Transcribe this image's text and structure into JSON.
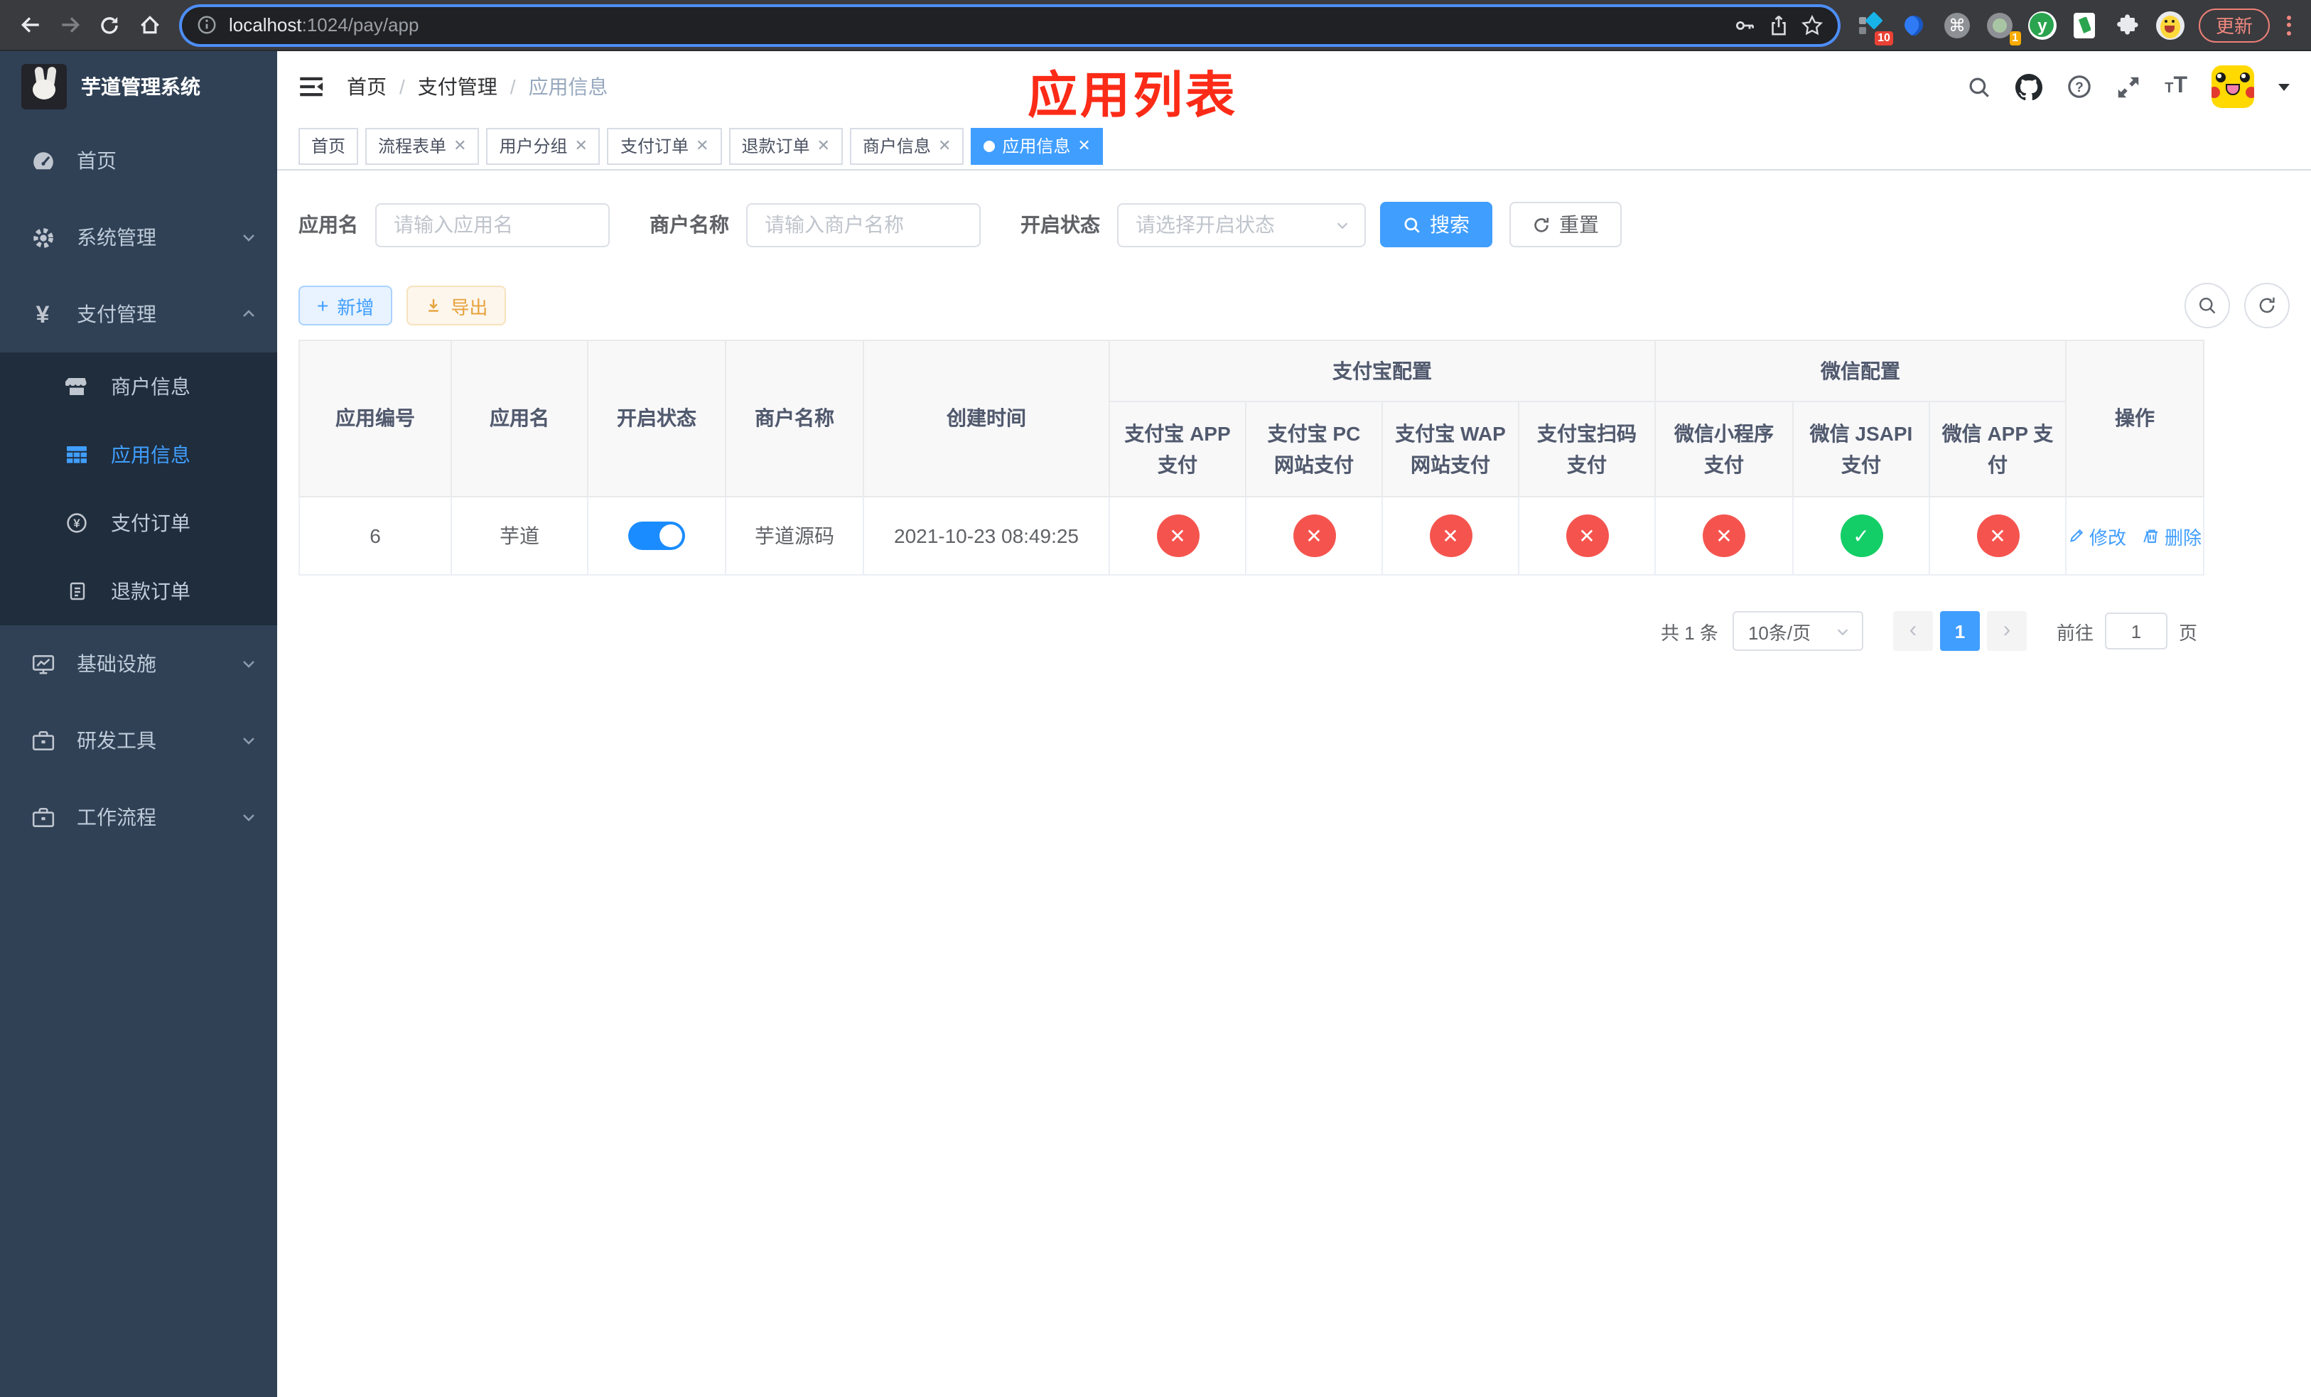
{
  "browser": {
    "url_host": "localhost",
    "url_path": ":1024/pay/app",
    "ext_badge_10": "10",
    "ext_badge_1": "1",
    "ext_y_label": "y",
    "update_label": "更新"
  },
  "sidebar": {
    "title": "芋道管理系统",
    "items": [
      {
        "label": "首页"
      },
      {
        "label": "系统管理"
      },
      {
        "label": "支付管理"
      },
      {
        "label": "商户信息"
      },
      {
        "label": "应用信息"
      },
      {
        "label": "支付订单"
      },
      {
        "label": "退款订单"
      },
      {
        "label": "基础设施"
      },
      {
        "label": "研发工具"
      },
      {
        "label": "工作流程"
      }
    ]
  },
  "navbar": {
    "breadcrumb": [
      "首页",
      "支付管理",
      "应用信息"
    ],
    "annotation": "应用列表"
  },
  "tabs": [
    {
      "label": "首页",
      "closable": false,
      "active": false
    },
    {
      "label": "流程表单",
      "closable": true,
      "active": false
    },
    {
      "label": "用户分组",
      "closable": true,
      "active": false
    },
    {
      "label": "支付订单",
      "closable": true,
      "active": false
    },
    {
      "label": "退款订单",
      "closable": true,
      "active": false
    },
    {
      "label": "商户信息",
      "closable": true,
      "active": false
    },
    {
      "label": "应用信息",
      "closable": true,
      "active": true
    }
  ],
  "filters": {
    "app_name_label": "应用名",
    "app_name_placeholder": "请输入应用名",
    "merchant_label": "商户名称",
    "merchant_placeholder": "请输入商户名称",
    "status_label": "开启状态",
    "status_placeholder": "请选择开启状态",
    "search_label": "搜索",
    "reset_label": "重置"
  },
  "toolbar": {
    "add_label": "新增",
    "export_label": "导出"
  },
  "table": {
    "columns": [
      "应用编号",
      "应用名",
      "开启状态",
      "商户名称",
      "创建时间"
    ],
    "groups": [
      {
        "label": "支付宝配置",
        "children": [
          "支付宝 APP 支付",
          "支付宝 PC 网站支付",
          "支付宝 WAP 网站支付",
          "支付宝扫码支付"
        ]
      },
      {
        "label": "微信配置",
        "children": [
          "微信小程序支付",
          "微信 JSAPI 支付",
          "微信 APP 支付"
        ]
      }
    ],
    "ops_label": "操作",
    "row": {
      "id": "6",
      "name": "芋道",
      "enabled": true,
      "merchant": "芋道源码",
      "created": "2021-10-23 08:49:25",
      "statuses": [
        {
          "state": "off",
          "glyph": "✕"
        },
        {
          "state": "off",
          "glyph": "✕"
        },
        {
          "state": "off",
          "glyph": "✕"
        },
        {
          "state": "off",
          "glyph": "✕"
        },
        {
          "state": "off",
          "glyph": "✕"
        },
        {
          "state": "on",
          "glyph": "✓"
        },
        {
          "state": "off",
          "glyph": "✕"
        }
      ],
      "edit_label": "修改",
      "delete_label": "删除"
    }
  },
  "pagination": {
    "total": "共 1 条",
    "page_size": "10条/页",
    "page": "1",
    "goto_label": "前往",
    "goto_value": "1",
    "page_unit": "页"
  },
  "colors": {
    "primary": "#409eff",
    "success": "#13ce66",
    "danger": "#f56c6c",
    "warning": "#e6a23c",
    "sidebar_bg": "#304156",
    "submenu_bg": "#1f2d3d",
    "annotation_red": "#fb2b17"
  }
}
